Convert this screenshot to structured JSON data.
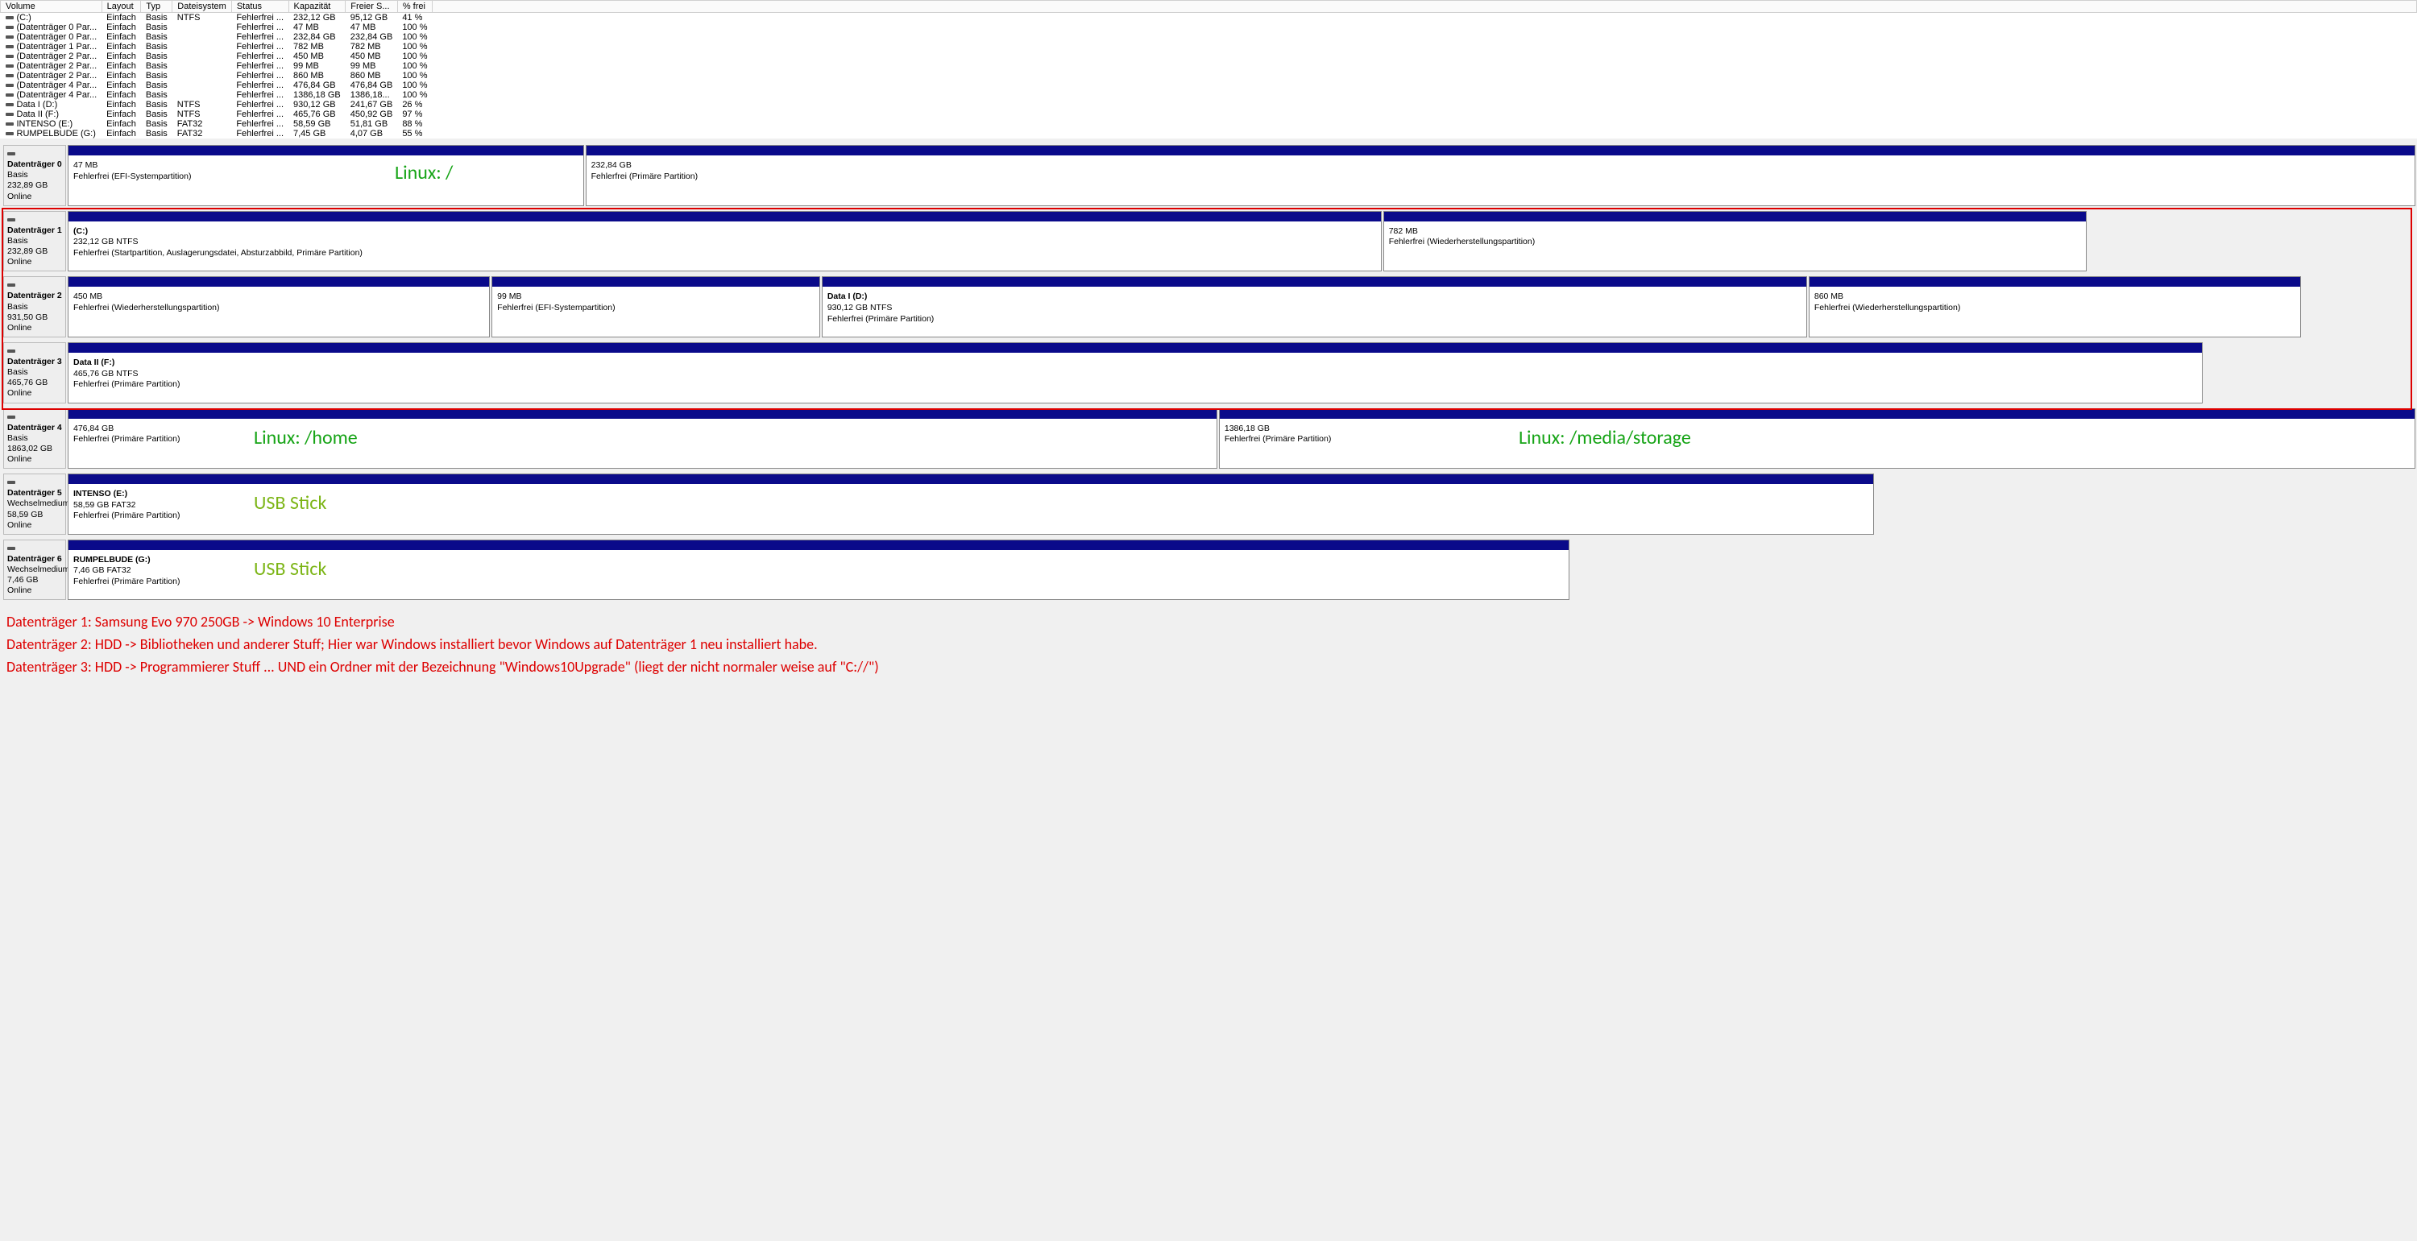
{
  "table": {
    "headers": [
      "Volume",
      "Layout",
      "Typ",
      "Dateisystem",
      "Status",
      "Kapazität",
      "Freier S...",
      "% frei"
    ],
    "rows": [
      {
        "vol": "(C:)",
        "layout": "Einfach",
        "typ": "Basis",
        "fs": "NTFS",
        "status": "Fehlerfrei ...",
        "cap": "232,12 GB",
        "free": "95,12 GB",
        "pct": "41 %"
      },
      {
        "vol": "(Datenträger 0 Par...",
        "layout": "Einfach",
        "typ": "Basis",
        "fs": "",
        "status": "Fehlerfrei ...",
        "cap": "47 MB",
        "free": "47 MB",
        "pct": "100 %"
      },
      {
        "vol": "(Datenträger 0 Par...",
        "layout": "Einfach",
        "typ": "Basis",
        "fs": "",
        "status": "Fehlerfrei ...",
        "cap": "232,84 GB",
        "free": "232,84 GB",
        "pct": "100 %"
      },
      {
        "vol": "(Datenträger 1 Par...",
        "layout": "Einfach",
        "typ": "Basis",
        "fs": "",
        "status": "Fehlerfrei ...",
        "cap": "782 MB",
        "free": "782 MB",
        "pct": "100 %"
      },
      {
        "vol": "(Datenträger 2 Par...",
        "layout": "Einfach",
        "typ": "Basis",
        "fs": "",
        "status": "Fehlerfrei ...",
        "cap": "450 MB",
        "free": "450 MB",
        "pct": "100 %"
      },
      {
        "vol": "(Datenträger 2 Par...",
        "layout": "Einfach",
        "typ": "Basis",
        "fs": "",
        "status": "Fehlerfrei ...",
        "cap": "99 MB",
        "free": "99 MB",
        "pct": "100 %"
      },
      {
        "vol": "(Datenträger 2 Par...",
        "layout": "Einfach",
        "typ": "Basis",
        "fs": "",
        "status": "Fehlerfrei ...",
        "cap": "860 MB",
        "free": "860 MB",
        "pct": "100 %"
      },
      {
        "vol": "(Datenträger 4 Par...",
        "layout": "Einfach",
        "typ": "Basis",
        "fs": "",
        "status": "Fehlerfrei ...",
        "cap": "476,84 GB",
        "free": "476,84 GB",
        "pct": "100 %"
      },
      {
        "vol": "(Datenträger 4 Par...",
        "layout": "Einfach",
        "typ": "Basis",
        "fs": "",
        "status": "Fehlerfrei ...",
        "cap": "1386,18 GB",
        "free": "1386,18...",
        "pct": "100 %"
      },
      {
        "vol": "Data I (D:)",
        "layout": "Einfach",
        "typ": "Basis",
        "fs": "NTFS",
        "status": "Fehlerfrei ...",
        "cap": "930,12 GB",
        "free": "241,67 GB",
        "pct": "26 %"
      },
      {
        "vol": "Data II (F:)",
        "layout": "Einfach",
        "typ": "Basis",
        "fs": "NTFS",
        "status": "Fehlerfrei ...",
        "cap": "465,76 GB",
        "free": "450,92 GB",
        "pct": "97 %"
      },
      {
        "vol": "INTENSO (E:)",
        "layout": "Einfach",
        "typ": "Basis",
        "fs": "FAT32",
        "status": "Fehlerfrei ...",
        "cap": "58,59 GB",
        "free": "51,81 GB",
        "pct": "88 %"
      },
      {
        "vol": "RUMPELBUDE (G:)",
        "layout": "Einfach",
        "typ": "Basis",
        "fs": "FAT32",
        "status": "Fehlerfrei ...",
        "cap": "7,45 GB",
        "free": "4,07 GB",
        "pct": "55 %"
      }
    ]
  },
  "disks": [
    {
      "title": "Datenträger 0",
      "type": "Basis",
      "cap": "232,89 GB",
      "state": "Online",
      "parts": [
        {
          "flex": 22,
          "name": "",
          "size": "47 MB",
          "status": "Fehlerfrei (EFI-Systempartition)"
        },
        {
          "flex": 78,
          "name": "",
          "size": "232,84 GB",
          "status": "Fehlerfrei (Primäre Partition)"
        }
      ]
    },
    {
      "title": "Datenträger 1",
      "type": "Basis",
      "cap": "232,89 GB",
      "state": "Online",
      "parts": [
        {
          "flex": 56,
          "name": "(C:)",
          "size": "232,12 GB NTFS",
          "status": "Fehlerfrei (Startpartition, Auslagerungsdatei, Absturzabbild, Primäre Partition)"
        },
        {
          "flex": 30,
          "name": "",
          "size": "782 MB",
          "status": "Fehlerfrei (Wiederherstellungspartition)"
        }
      ]
    },
    {
      "title": "Datenträger 2",
      "type": "Basis",
      "cap": "931,50 GB",
      "state": "Online",
      "parts": [
        {
          "flex": 18,
          "name": "",
          "size": "450 MB",
          "status": "Fehlerfrei (Wiederherstellungspartition)"
        },
        {
          "flex": 14,
          "name": "",
          "size": "99 MB",
          "status": "Fehlerfrei (EFI-Systempartition)"
        },
        {
          "flex": 42,
          "name": "Data I  (D:)",
          "size": "930,12 GB NTFS",
          "status": "Fehlerfrei (Primäre Partition)"
        },
        {
          "flex": 21,
          "name": "",
          "size": "860 MB",
          "status": "Fehlerfrei (Wiederherstellungspartition)"
        }
      ]
    },
    {
      "title": "Datenträger 3",
      "type": "Basis",
      "cap": "465,76 GB",
      "state": "Online",
      "parts": [
        {
          "flex": 91,
          "name": "Data II  (F:)",
          "size": "465,76 GB NTFS",
          "status": "Fehlerfrei (Primäre Partition)"
        }
      ]
    },
    {
      "title": "Datenträger 4",
      "type": "Basis",
      "cap": "1863,02 GB",
      "state": "Online",
      "parts": [
        {
          "flex": 49,
          "name": "",
          "size": "476,84 GB",
          "status": "Fehlerfrei (Primäre Partition)"
        },
        {
          "flex": 51,
          "name": "",
          "size": "1386,18 GB",
          "status": "Fehlerfrei (Primäre Partition)"
        }
      ]
    },
    {
      "title": "Datenträger 5",
      "type": "Wechselmedium",
      "cap": "58,59 GB",
      "state": "Online",
      "parts": [
        {
          "flex": 77,
          "name": "INTENSO  (E:)",
          "size": "58,59 GB FAT32",
          "status": "Fehlerfrei (Primäre Partition)"
        }
      ]
    },
    {
      "title": "Datenträger 6",
      "type": "Wechselmedium",
      "cap": "7,46 GB",
      "state": "Online",
      "parts": [
        {
          "flex": 64,
          "name": "RUMPELBUDE  (G:)",
          "size": "7,46 GB FAT32",
          "status": "Fehlerfrei (Primäre Partition)"
        }
      ]
    }
  ],
  "annotations": {
    "d0": "Linux: /",
    "d4a": "Linux: /home",
    "d4b": "Linux: /media/storage",
    "d5": "USB Stick",
    "d6": "USB Stick"
  },
  "notes": [
    "Datenträger 1: Samsung Evo 970  250GB -> Windows 10 Enterprise",
    "Datenträger 2: HDD -> Bibliotheken und anderer Stuff; Hier war Windows installiert bevor Windows auf Datenträger 1 neu installiert habe.",
    "Datenträger 3: HDD -> Programmierer Stuff ... UND ein Ordner mit der Bezeichnung \"Windows10Upgrade\" (liegt der nicht normaler weise auf \"C://\")"
  ]
}
